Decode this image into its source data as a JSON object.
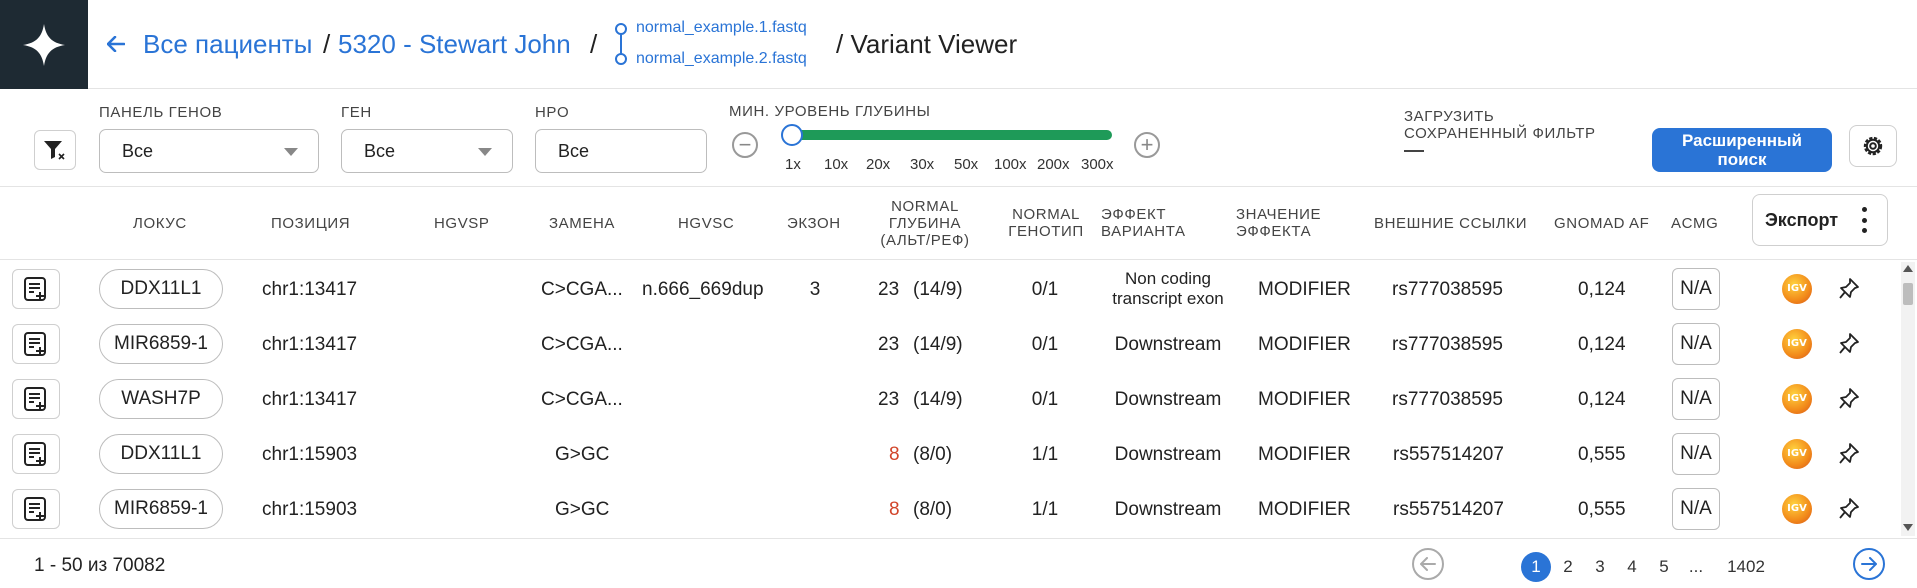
{
  "header": {
    "back_icon": "arrow-left-icon",
    "crumb_patients": "Все пациенты",
    "sep": "/",
    "crumb_patient": "5320 - Stewart John",
    "files": [
      "normal_example.1.fastq",
      "normal_example.2.fastq"
    ],
    "crumb_current": "/ Variant Viewer"
  },
  "filters": {
    "gene_panel": {
      "label": "Панель генов",
      "value": "Все"
    },
    "gene": {
      "label": "Ген",
      "value": "Все"
    },
    "hpo": {
      "label": "HPO",
      "value": "Все"
    },
    "depth": {
      "label": "Мин. уровень глубины",
      "ticks": [
        "1x",
        "10x",
        "20x",
        "30x",
        "50x",
        "100x",
        "200x",
        "300x"
      ],
      "selected_index": 0,
      "minus": "−",
      "plus": "+"
    },
    "load_saved": {
      "line1": "Загрузить",
      "line2": "сохраненный фильтр",
      "value": "—"
    },
    "advanced_search": {
      "line1": "Расширенный",
      "line2": "поиск"
    }
  },
  "table": {
    "columns": {
      "locus": "Локус",
      "position": "Позиция",
      "hgvsp": "HGVSP",
      "change": "Замена",
      "hgvsc": "HGVSC",
      "exon": "Экзон",
      "depth_l1": "Normal",
      "depth_l2": "глубина",
      "depth_l3": "(Альт/Реф)",
      "genotype_l1": "Normal",
      "genotype_l2": "генотип",
      "effect_l1": "Эффект",
      "effect_l2": "варианта",
      "impact_l1": "Значение",
      "impact_l2": "эффекта",
      "links": "Внешние ссылки",
      "gnomad": "gnomAD AF",
      "acmg": "ACMG"
    },
    "export_label": "Экспорт",
    "rows": [
      {
        "locus": "DDX11L1",
        "position": "chr1:13417",
        "hgvsp": "",
        "change": "C>CGA...",
        "hgvsc": "n.666_669dup",
        "exon": "3",
        "depth": "23",
        "ratio": "(14/9)",
        "genotype": "0/1",
        "effect_l1": "Non coding",
        "effect_l2": "transcript exon",
        "impact": "MODIFIER",
        "link": "rs777038595",
        "gnomad": "0,124",
        "acmg": "N/A"
      },
      {
        "locus": "MIR6859-1",
        "position": "chr1:13417",
        "hgvsp": "",
        "change": "C>CGA...",
        "hgvsc": "",
        "exon": "",
        "depth": "23",
        "ratio": "(14/9)",
        "genotype": "0/1",
        "effect": "Downstream",
        "impact": "MODIFIER",
        "link": "rs777038595",
        "gnomad": "0,124",
        "acmg": "N/A"
      },
      {
        "locus": "WASH7P",
        "position": "chr1:13417",
        "hgvsp": "",
        "change": "C>CGA...",
        "hgvsc": "",
        "exon": "",
        "depth": "23",
        "ratio": "(14/9)",
        "genotype": "0/1",
        "effect": "Downstream",
        "impact": "MODIFIER",
        "link": "rs777038595",
        "gnomad": "0,124",
        "acmg": "N/A"
      },
      {
        "locus": "DDX11L1",
        "position": "chr1:15903",
        "hgvsp": "",
        "change": "G>GC",
        "hgvsc": "",
        "exon": "",
        "depth": "8",
        "ratio": "(8/0)",
        "genotype": "1/1",
        "effect": "Downstream",
        "impact": "MODIFIER",
        "link": "rs557514207",
        "gnomad": "0,555",
        "acmg": "N/A"
      },
      {
        "locus": "MIR6859-1",
        "position": "chr1:15903",
        "hgvsp": "",
        "change": "G>GC",
        "hgvsc": "",
        "exon": "",
        "depth": "8",
        "ratio": "(8/0)",
        "genotype": "1/1",
        "effect": "Downstream",
        "impact": "MODIFIER",
        "link": "rs557514207",
        "gnomad": "0,555",
        "acmg": "N/A"
      }
    ],
    "igv_label": "IGV"
  },
  "footer": {
    "range": "1 - 50 из 70082",
    "pages": [
      "1",
      "2",
      "3",
      "4",
      "5",
      "...",
      "1402"
    ],
    "current_page": "1"
  },
  "colors": {
    "accent": "#2a74d6",
    "logo_bg": "#1e2a33",
    "slider": "#1e9a58",
    "depth_high": "#e07a2a",
    "depth_low": "#d2452a",
    "modifier": "#9a9a9a"
  }
}
